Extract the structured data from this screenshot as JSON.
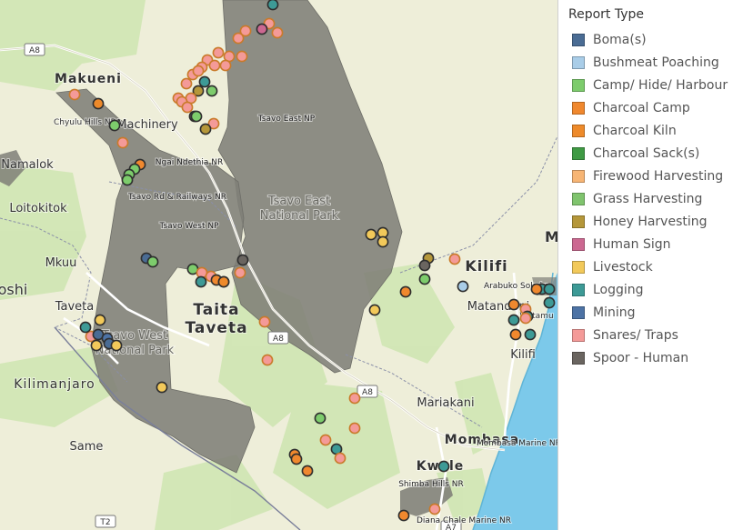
{
  "legend": {
    "title": "Report Type",
    "items": [
      {
        "label": "Boma(s)",
        "color": "#4a6c94"
      },
      {
        "label": "Bushmeat Poaching",
        "color": "#a9cde8"
      },
      {
        "label": "Camp/ Hide/ Harbour",
        "color": "#7dcc6c"
      },
      {
        "label": "Charcoal Camp",
        "color": "#f0882e"
      },
      {
        "label": "Charcoal Kiln",
        "color": "#ee8a2a"
      },
      {
        "label": "Charcoal Sack(s)",
        "color": "#3f9a44"
      },
      {
        "label": "Firewood Harvesting",
        "color": "#f7b574"
      },
      {
        "label": "Grass Harvesting",
        "color": "#80c46e"
      },
      {
        "label": "Honey Harvesting",
        "color": "#b5973a"
      },
      {
        "label": "Human Sign",
        "color": "#cc6891"
      },
      {
        "label": "Livestock",
        "color": "#f2c95a"
      },
      {
        "label": "Logging",
        "color": "#3d9a96"
      },
      {
        "label": "Mining",
        "color": "#4d73a5"
      },
      {
        "label": "Snares/ Traps",
        "color": "#f49a98"
      },
      {
        "label": "Spoor - Human",
        "color": "#6a6560"
      }
    ]
  },
  "map": {
    "places": [
      {
        "name": "Makueni",
        "kind": "town"
      },
      {
        "name": "Chyulu Hills NP",
        "kind": "park"
      },
      {
        "name": "Machinery",
        "kind": "town"
      },
      {
        "name": "Namalok",
        "kind": "town"
      },
      {
        "name": "Loitokitok",
        "kind": "town"
      },
      {
        "name": "Mkuu",
        "kind": "town"
      },
      {
        "name": "oshi",
        "kind": "town"
      },
      {
        "name": "Taveta",
        "kind": "town"
      },
      {
        "name": "Taita",
        "kind": "region"
      },
      {
        "name": "Taveta",
        "kind": "region"
      },
      {
        "name": "Kilimanjaro",
        "kind": "town"
      },
      {
        "name": "Same",
        "kind": "town"
      },
      {
        "name": "Tsavo East NP",
        "kind": "park"
      },
      {
        "name": "Ngai Ndethia NR",
        "kind": "park"
      },
      {
        "name": "Tsavo Rd & Railways NR",
        "kind": "park"
      },
      {
        "name": "Tsavo West NP",
        "kind": "park"
      },
      {
        "name": "Tsavo East",
        "kind": "base"
      },
      {
        "name": "National Park",
        "kind": "base"
      },
      {
        "name": "Tsavo West",
        "kind": "base"
      },
      {
        "name": "National Park",
        "kind": "base"
      },
      {
        "name": "Kilifi",
        "kind": "region"
      },
      {
        "name": "Arabuko Sokoke",
        "kind": "park"
      },
      {
        "name": "Matandoni",
        "kind": "town"
      },
      {
        "name": "Watamu",
        "kind": "town"
      },
      {
        "name": "Kilifi",
        "kind": "town"
      },
      {
        "name": "Mariakani",
        "kind": "town"
      },
      {
        "name": "Mombasa",
        "kind": "region"
      },
      {
        "name": "Mombasa Marine NP",
        "kind": "park"
      },
      {
        "name": "Kwale",
        "kind": "region"
      },
      {
        "name": "Shimba Hills NR",
        "kind": "park"
      },
      {
        "name": "Diana Chale Marine NR",
        "kind": "park"
      },
      {
        "name": "M",
        "kind": "region"
      }
    ],
    "roads": [
      "A8",
      "A8",
      "A8",
      "T2",
      "A7"
    ]
  }
}
